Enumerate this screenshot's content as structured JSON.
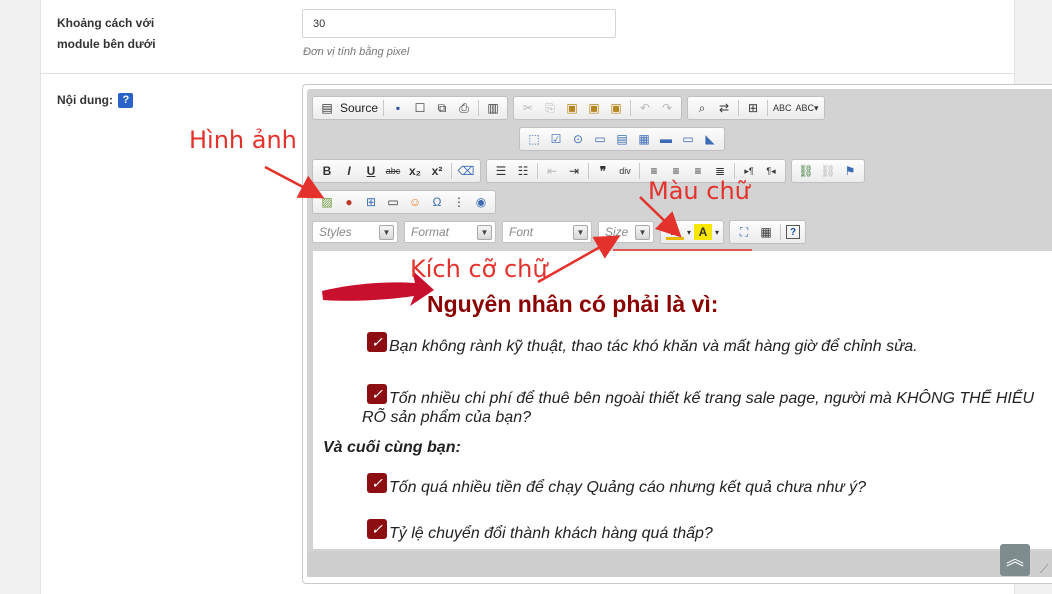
{
  "fields": {
    "spacing": {
      "label_line1": "Khoảng cách với",
      "label_line2": "module bên dưới",
      "value": "30",
      "hint": "Đơn vị tính bằng pixel"
    },
    "content": {
      "label": "Nội dung:",
      "help": "?"
    }
  },
  "toolbar": {
    "source_label": "Source",
    "styles_label": "Styles",
    "format_label": "Format",
    "font_label": "Font",
    "size_label": "Size",
    "help_label": "?"
  },
  "content": {
    "heading": "Nguyên nhân có phải là vì:",
    "items1": [
      "Bạn không rành kỹ thuật, thao tác khó khăn và mất hàng giờ để chỉnh sửa.",
      "Tốn nhiều chi phí để thuê bên ngoài thiết kế trang sale page, người mà KHÔNG THỂ HIỂU"
    ],
    "item1_cont": "RÕ sản phẩm của bạn?",
    "subheading": "Và cuối cùng bạn:",
    "items2": [
      "Tốn quá nhiều tiền để chạy Quảng cáo nhưng kết quả chưa như ý?",
      "Tỷ lệ chuyển đổi thành khách hàng quá thấp?"
    ]
  },
  "annotations": {
    "image": "Hình ảnh",
    "color": "Màu chữ",
    "size": "Kích cỡ chữ"
  },
  "colors": {
    "annotation": "#e4312b",
    "heading": "#8b0000",
    "check": "#8c0d12"
  }
}
